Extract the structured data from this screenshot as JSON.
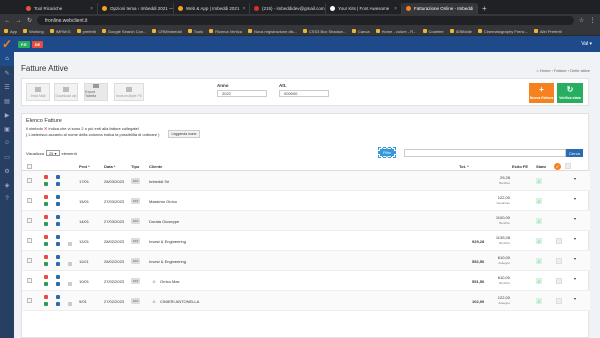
{
  "browser": {
    "tabs": [
      {
        "label": "Tool Ricariche",
        "color": "#e8543a"
      },
      {
        "label": "Opzioni tema ‹ Imbeddi 2021 — W...",
        "color": "#f4a124"
      },
      {
        "label": "Web & App | Imbeddi 2021",
        "color": "#f4a124"
      },
      {
        "label": "(215) - imbeddidev@gmail.com",
        "color": "#d93025"
      },
      {
        "label": "Your Kits | Font Awesome",
        "color": "#ffffff"
      },
      {
        "label": "Fatturazione Online - Imbeddi",
        "color": "#f5821f",
        "active": true
      }
    ],
    "url": "fronline.webclient.it",
    "bookmarks": [
      "App",
      "Working",
      "IMPAKS",
      "preferiti",
      "Google Search Con...",
      "CRMImbeddi",
      "Tools",
      "Ricerca Vertica",
      "Nova registrazione dis...",
      "CSS3 Box Shadow...",
      "Canva",
      "Home - colore - R...",
      "Codefee",
      "IDSfiddle",
      "Cinematography Frenc...",
      "Altri Preferiti"
    ]
  },
  "app": {
    "user_label": "Val ▾",
    "header_buttons": [
      {
        "label": "F.E",
        "color": "#27ae60"
      },
      {
        "label": "DE",
        "color": "#e74c3c"
      }
    ]
  },
  "sidebar_icons": [
    "home-icon",
    "edit-icon",
    "file-icon",
    "chart-icon",
    "truck-icon",
    "box-icon",
    "users-icon",
    "card-icon",
    "gear-icon",
    "shield-icon",
    "help-icon"
  ],
  "page": {
    "title": "Fatture Attive",
    "breadcrumb": "⌂ Home  ›  Fatture  ›  Delle attive"
  },
  "toolbar": {
    "gray_buttons": [
      "Invia Mail",
      "Download zip",
      "Export Tabella",
      "Invia multiple FE"
    ],
    "anno_label": "Anno",
    "anno_value": "2022",
    "attivita_label": "Att.",
    "attivita_value": "000000",
    "new_invoice": "Nuova Fattura",
    "verify": "Verifica stato"
  },
  "list": {
    "title": "Elenco Fatture",
    "note1_pre": "Il simbolo ",
    "note1_mark": "✕",
    "note1_post": " indica che vi sono 2 o più enti alla fatture collegate!",
    "note2": "( L'asterisco accanto al nome della colonna indica la possibilità di ordinare )",
    "legend_button": "Leggenda icone",
    "show_label": "Visualizza",
    "show_value": "25 ▾",
    "show_suffix": "elementi",
    "filter_button": "Filtro",
    "search_button": "Cerca"
  },
  "table": {
    "headers": {
      "prot": "Prot *",
      "data": "Data *",
      "tipo": "Tipo",
      "cliente": "Cliente",
      "tot": "Tot. *",
      "esito": "Esito FE",
      "stato": "Stato"
    },
    "rows": [
      {
        "prot": "17/01",
        "data": "28/03/2023",
        "tipo": "FAT",
        "cliente": "Imbeddi Srl",
        "tot_main": "",
        "tot_right": "29,28",
        "tot_sub": "Bonifico"
      },
      {
        "prot": "15/01",
        "data": "27/03/2023",
        "tipo": "FAT",
        "cliente": "Massimo Orrico",
        "tot_main": "",
        "tot_right": "122,00",
        "tot_sub": "Sopanzau"
      },
      {
        "prot": "14/01",
        "data": "27/03/2023",
        "tipo": "FAT",
        "cliente": "Dorata Giuseppe",
        "tot_main": "",
        "tot_right": "1100,00",
        "tot_sub": "Bonifico"
      },
      {
        "prot": "12/01",
        "data": "28/02/2023",
        "tipo": "FAT",
        "cliente": "Invest & Engineering",
        "tot_main": "929,28",
        "tot_right": "1139,28",
        "tot_sub": "Bonifico"
      },
      {
        "prot": "11/01",
        "data": "28/02/2023",
        "tipo": "FAT",
        "cliente": "Invest & Engineering",
        "tot_main": "552,50",
        "tot_right": "610,00",
        "tot_sub": "Assegno"
      },
      {
        "prot": "10/01",
        "data": "27/02/2023",
        "tipo": "FAT",
        "cliente": "Orrico Max",
        "tot_main": "551,50",
        "tot_right": "610,00",
        "tot_sub": "Bonifico"
      },
      {
        "prot": "9/01",
        "data": "27/02/2023",
        "tipo": "FAT",
        "cliente": "CINIERI ANTONELLA",
        "tot_main": "102,00",
        "tot_right": "122,00",
        "tot_sub": "Assegno"
      }
    ]
  }
}
